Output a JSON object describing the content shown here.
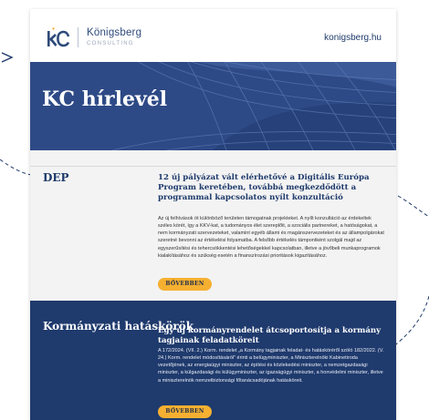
{
  "header": {
    "logo_name": "Königsberg",
    "logo_sub": "CONSULTING",
    "site": "konigsberg.hu"
  },
  "hero": {
    "title": "KC hírlevél"
  },
  "sections": [
    {
      "label": "DEP",
      "title": "12 új pályázat vált elérhetővé a Digitális Európa Program keretében, továbbá megkezdődött a programmal kapcsolatos nyílt konzultáció",
      "body": "Az új felhívások öt különböző területen támogatnak projekteket. A nyílt konzultáció az érdekeltek széles körét, így a KKV-kat, a tudományos élet szereplőit, a szociális partnereket, a hatóságokat, a nem kormányzati szervezeteket, valamint egyéb állami és magánszervezeteket és az állampolgárokat szeretné bevonni az értékelési folyamatba. A felsőbb értékelés támpontként szolgál majd az egyszerűsítési és tehercsökkentési lehetőségekkel kapcsolatban, illetve a jövőbeli munkaprogramok kialakításához és szükség esetén a finanszírozási prioritások kigazításához.",
      "button": "BŐVEBBEN"
    },
    {
      "label": "Kormányzati hatáskörök",
      "title": "Egy új kormányrendelet átcsoportosítja a kormány tagjainak feladatköreit",
      "body": "A 172/2024. (VII. 2.) Korm. rendelet „a Kormány tagjainak feladat- és hatásköréről szóló 182/2022. (V. 24.) Korm. rendelet módosításáról” érinti a belügyminiszter, a Miniszterelnöki Kabinetiroda vezetőjének, az energiaügyi miniszter, az építési és közlekedési miniszter, a nemzetgazdasági miniszter, a külgazdasági és külügyminiszter, az igazságügyi miniszter, a honvédelmi miniszter, illetve a miniszterelnök nemzetbiztonsági főtanácsadójának hatásköreit.",
      "button": "BŐVEBBEN"
    }
  ],
  "colors": {
    "brand_navy": "#1f3a6d",
    "hero_blue": "#2e4a86",
    "accent_orange": "#f5b031",
    "section_gray": "#f3f3f3"
  }
}
